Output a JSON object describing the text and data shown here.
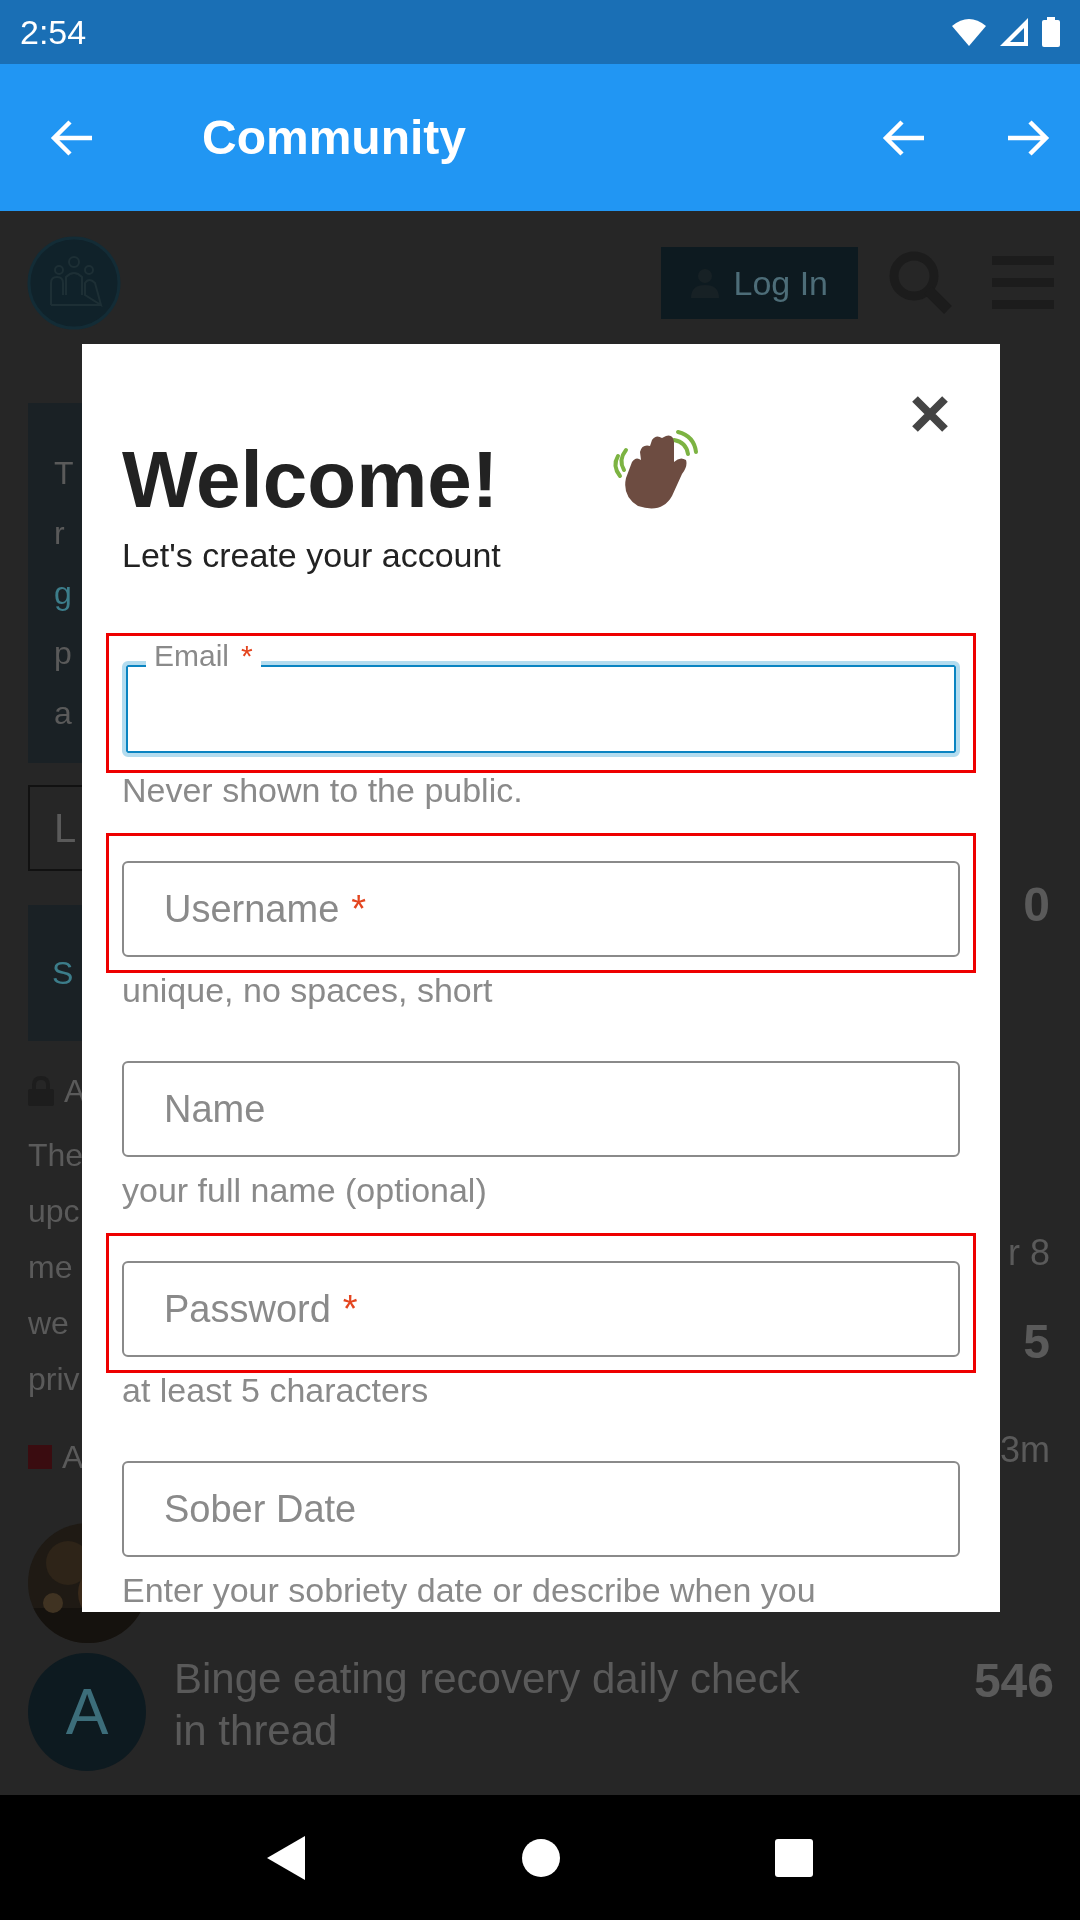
{
  "status_bar": {
    "time": "2:54"
  },
  "app_bar": {
    "title": "Community"
  },
  "site_header": {
    "login_button": "Log In"
  },
  "background": {
    "left_fragments": [
      {
        "text": "T",
        "kind": "text"
      },
      {
        "text": "r",
        "kind": "text"
      },
      {
        "text": "g",
        "kind": "link"
      },
      {
        "text": "p",
        "kind": "text"
      },
      {
        "text": "a",
        "kind": "text"
      }
    ],
    "button_fragment": "L",
    "banner_fragment": "S",
    "topic_meta_fragment": "A",
    "excerpt_fragments": [
      "The",
      "upc",
      "me",
      "we",
      "priv"
    ],
    "category_fragment": "A",
    "right_counts": [
      {
        "text": "0",
        "kind": "count"
      },
      {
        "text": "r 8",
        "kind": "meta"
      },
      {
        "text": "5",
        "kind": "count"
      },
      {
        "text": "3m",
        "kind": "meta"
      }
    ],
    "last_topic": {
      "avatar_letter": "A",
      "title": "Binge eating recovery daily check in thread",
      "replies": "546"
    }
  },
  "modal": {
    "title": "Welcome!",
    "subtitle": "Let's create your account",
    "fields": [
      {
        "label": "Email",
        "required_mark": "*",
        "focused": true,
        "highlighted": true,
        "helper": "Never shown to the public."
      },
      {
        "label": "Username",
        "required_mark": "*",
        "focused": false,
        "highlighted": true,
        "helper": "unique, no spaces, short"
      },
      {
        "label": "Name",
        "focused": false,
        "highlighted": false,
        "helper": "your full name (optional)"
      },
      {
        "label": "Password",
        "required_mark": "*",
        "focused": false,
        "highlighted": true,
        "helper": "at least 5 characters"
      },
      {
        "label": "Sober Date",
        "focused": false,
        "highlighted": false,
        "helper": "Enter your sobriety date or describe when you"
      }
    ]
  }
}
